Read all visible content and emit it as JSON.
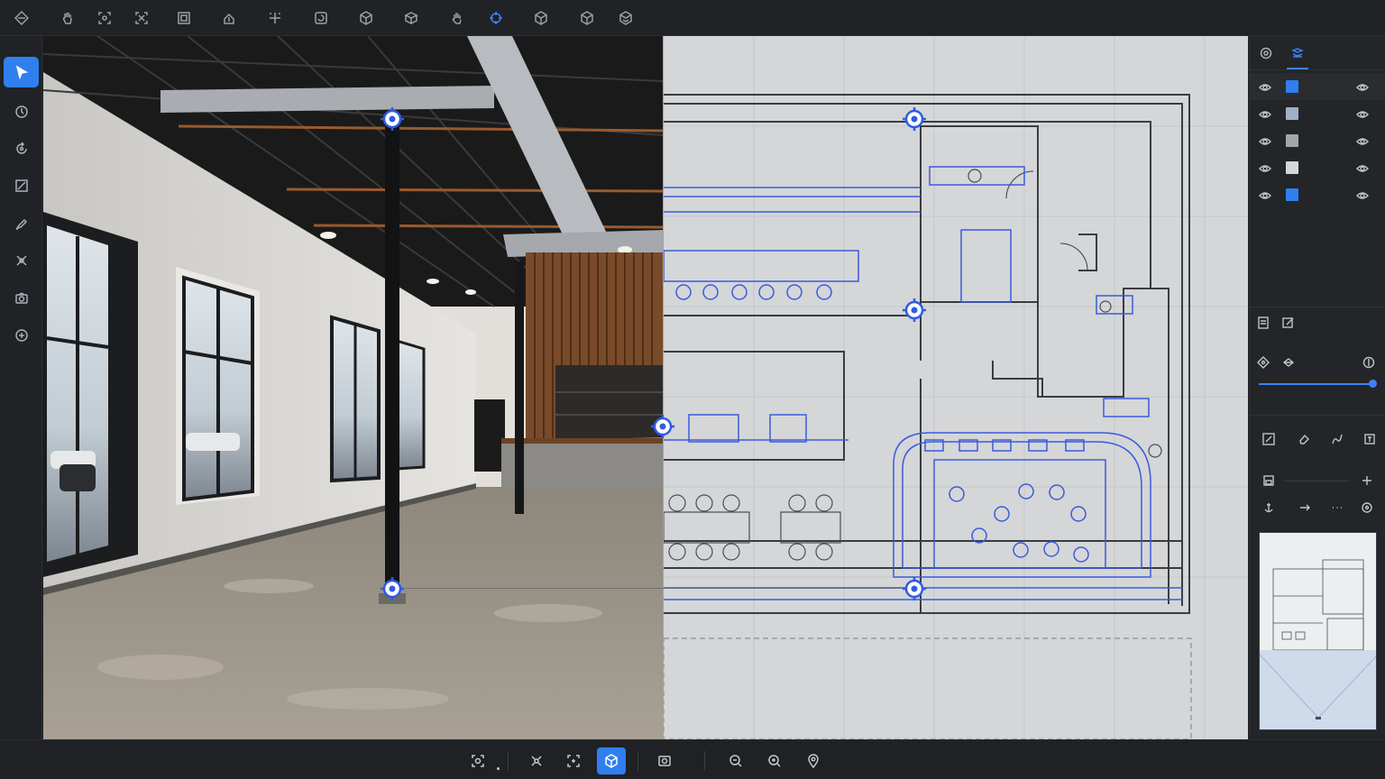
{
  "colors": {
    "accent": "#3b82f6",
    "panel_bg": "#202225",
    "plan_bg": "#d4d6d8",
    "plan_blue": "#3b5bdb"
  },
  "top_toolbar": {
    "icons": [
      "navigate-icon",
      "pan-hand-icon",
      "select-region-icon",
      "transform-icon",
      "crop-icon",
      "upload-icon",
      "add-point-icon",
      "rotate-view-icon",
      "cube-icon",
      "box-icon",
      "grab-icon",
      "align-target-icon",
      "cube-wire-icon",
      "cube-solid-icon",
      "cube-rotate-icon"
    ],
    "active": "align-target-icon"
  },
  "left_toolbar": {
    "icons": [
      "pointer-icon",
      "measure-icon",
      "rotate-icon",
      "image-edit-icon",
      "pen-icon",
      "transform-points-icon",
      "camera-icon",
      "add-icon"
    ],
    "active": "pointer-icon"
  },
  "right_panel": {
    "tabs": [
      "visibility-tab-icon",
      "layers-tab-icon"
    ],
    "active_tab": "layers-tab-icon",
    "layers": [
      {
        "color": "#2f7fef",
        "visible": true,
        "selected": true
      },
      {
        "color": "#9fb0c8",
        "visible": true,
        "selected": false
      },
      {
        "color": "#a3a5a8",
        "visible": true,
        "selected": false
      },
      {
        "color": "#d4d6d8",
        "visible": true,
        "selected": false
      },
      {
        "color": "#2f7fef",
        "visible": true,
        "selected": false
      }
    ],
    "opacity_level": 1.0
  },
  "bottom_toolbar": {
    "icons": [
      "focus-icon",
      "explode-icon",
      "fit-icon",
      "3d-cube-icon",
      "screenshot-icon",
      "zoom-out-icon",
      "zoom-in-icon",
      "location-icon"
    ],
    "active": "3d-cube-icon"
  }
}
